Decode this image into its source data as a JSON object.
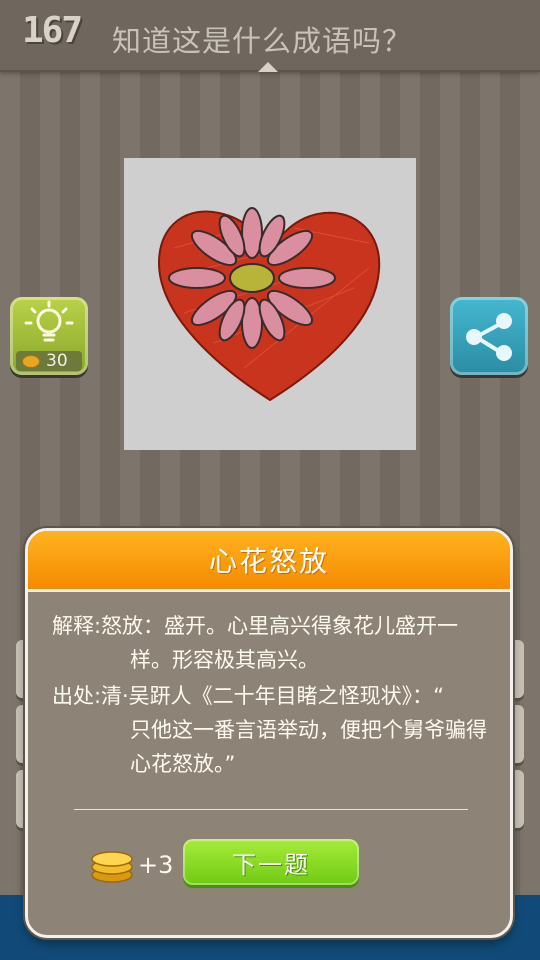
{
  "header": {
    "level": "167",
    "question": "知道这是什么成语吗？"
  },
  "hint": {
    "cost": "30",
    "icon": "lightbulb-icon"
  },
  "share": {
    "icon": "share-icon"
  },
  "puzzle": {
    "description_icon": "heart-flower-drawing"
  },
  "dialog": {
    "title": "心花怒放",
    "meaning_label": "解释:",
    "meaning_line1": "怒放：盛开。心里高兴得象花儿盛开一",
    "meaning_line2": "样。形容极其高兴。",
    "source_label": "出处:",
    "source_line1": "清·吴趼人《二十年目睹之怪现状》：“",
    "source_line2": "只他这一番言语举动，便把个舅爷骗得",
    "source_line3": "心花怒放。”",
    "reward": "+3",
    "next_label": "下一题"
  },
  "colors": {
    "header_orange": "#f58a00",
    "next_green": "#7fd41c",
    "hint_green": "#9bb83a",
    "share_blue": "#35a0b8"
  }
}
